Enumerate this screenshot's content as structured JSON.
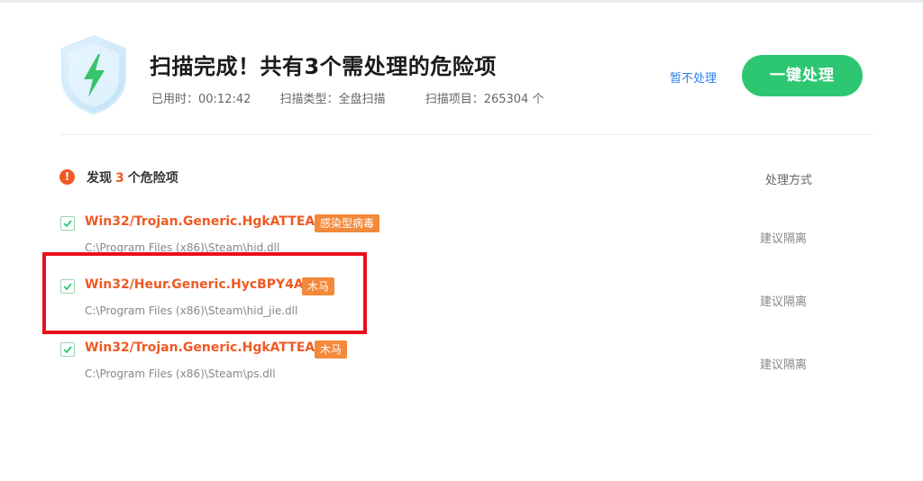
{
  "header": {
    "title": "扫描完成！共有3个需处理的危险项",
    "elapsed": "已用时：00:12:42",
    "scan_type": "扫描类型：全盘扫描",
    "scan_items": "扫描项目：265304 个",
    "ignore_label": "暂不处理",
    "fix_label": "一键处理"
  },
  "summary": {
    "prefix": "发现",
    "count": "3",
    "suffix": "个危险项",
    "method_header": "处理方式",
    "warn_glyph": "!"
  },
  "threats": [
    {
      "name": "Win32/Trojan.Generic.HgkATTEA",
      "tag": "感染型病毒",
      "path": "C:\\Program Files (x86)\\Steam\\hid.dll",
      "advice": "建议隔离",
      "checked": true
    },
    {
      "name": "Win32/Heur.Generic.HycBPY4A",
      "tag": "木马",
      "path": "C:\\Program Files (x86)\\Steam\\hid_jie.dll",
      "advice": "建议隔离",
      "checked": true
    },
    {
      "name": "Win32/Trojan.Generic.HgkATTEA",
      "tag": "木马",
      "path": "C:\\Program Files (x86)\\Steam\\ps.dll",
      "advice": "建议隔离",
      "checked": true
    }
  ],
  "colors": {
    "accent_green": "#2dc772",
    "danger_orange": "#ee5a24",
    "tag_orange": "#f3893a",
    "highlight_red": "#e8101b",
    "link_blue": "#2f80ed"
  }
}
